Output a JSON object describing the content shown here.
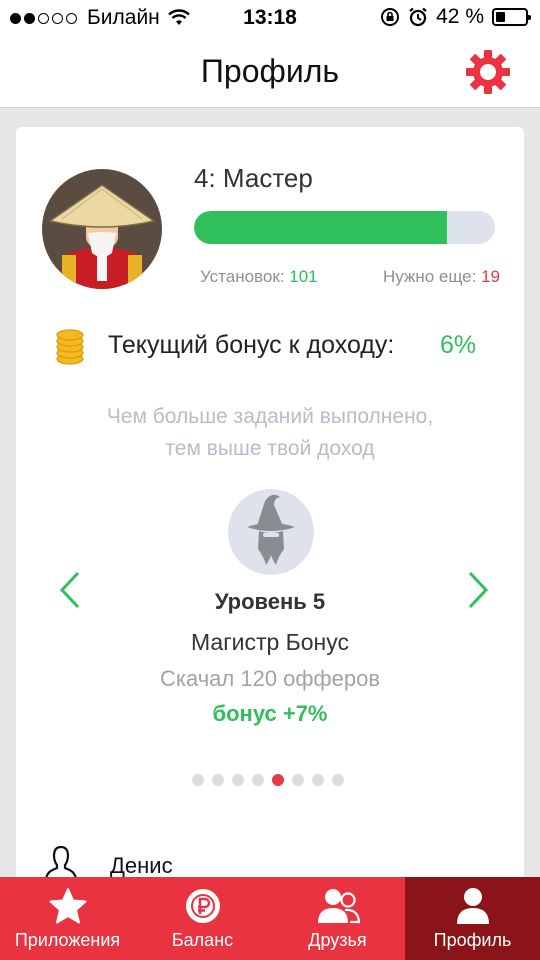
{
  "status_bar": {
    "carrier": "Билайн",
    "time": "13:18",
    "battery": "42 %",
    "battery_level": 0.42
  },
  "header": {
    "title": "Профиль"
  },
  "profile": {
    "level_name": "4: Мастер",
    "progress": 0.84,
    "installs_label": "Установок:",
    "installs_value": "101",
    "needed_label": "Нужно еще:",
    "needed_value": "19"
  },
  "bonus": {
    "label": "Текущий бонус к доходу:",
    "value": "6%"
  },
  "hint": {
    "line1": "Чем больше заданий выполнено,",
    "line2": "тем выше твой доход"
  },
  "next_level": {
    "number": "Уровень 5",
    "rank": "Магистр Бонус",
    "description": "Скачал 120 офферов",
    "bonus": "бонус +7%"
  },
  "pager": {
    "count": 8,
    "active": 4
  },
  "user": {
    "name": "Денис"
  },
  "tabs": [
    {
      "label": "Приложения",
      "icon": "star-icon"
    },
    {
      "label": "Баланс",
      "icon": "ruble-coin-icon"
    },
    {
      "label": "Друзья",
      "icon": "friends-icon"
    },
    {
      "label": "Профиль",
      "icon": "profile-icon",
      "active": true
    }
  ],
  "colors": {
    "accent_red": "#ea3340",
    "active_tab": "#8a1418",
    "green": "#2fbf5b"
  }
}
